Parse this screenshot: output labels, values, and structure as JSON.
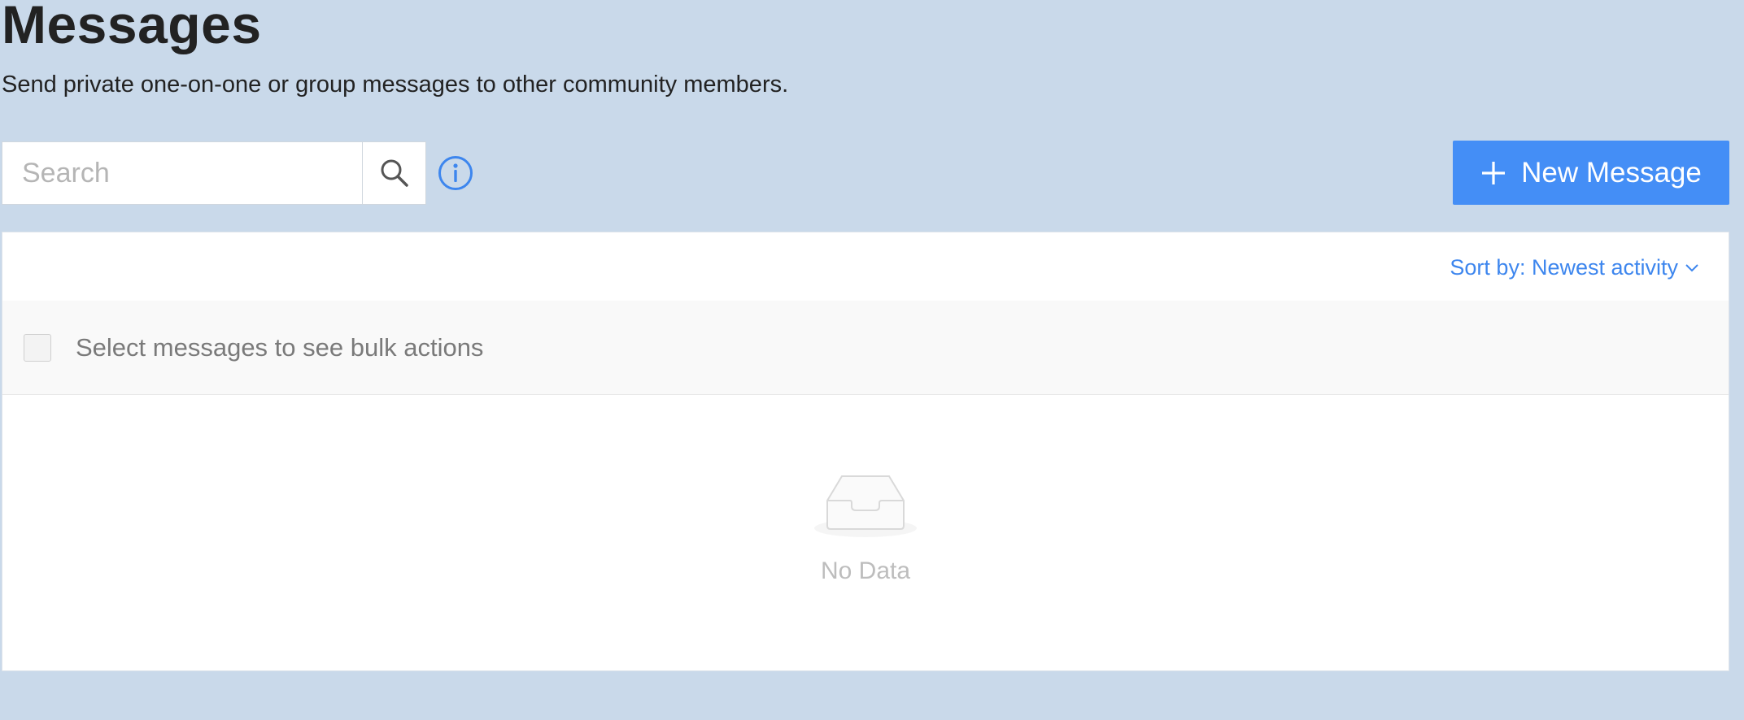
{
  "header": {
    "title": "Messages",
    "subtitle": "Send private one-on-one or group messages to other community members."
  },
  "search": {
    "placeholder": "Search",
    "value": "",
    "button_icon": "search-icon"
  },
  "info": {
    "icon": "info-icon"
  },
  "actions": {
    "new_message_label": "New Message",
    "new_message_icon": "plus-icon"
  },
  "list": {
    "sort_label": "Sort by: Newest activity",
    "sort_icon": "chevron-down-icon",
    "bulk_actions_label": "Select messages to see bulk actions",
    "empty_text": "No Data",
    "empty_icon": "inbox-icon"
  },
  "colors": {
    "page_background": "#c9d9ea",
    "accent": "#448ef6",
    "link": "#3d86ee",
    "muted_text": "#7a7a7a"
  }
}
